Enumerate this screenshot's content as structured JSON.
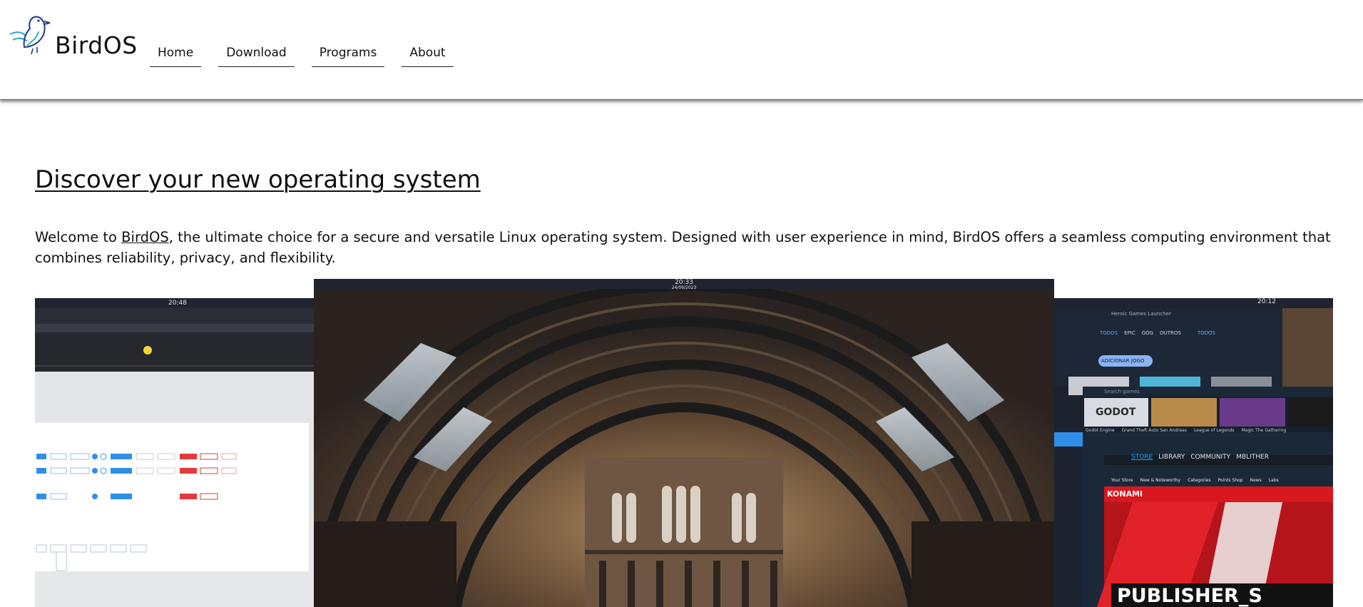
{
  "header": {
    "brand": "BirdOS",
    "nav": [
      {
        "label": "Home"
      },
      {
        "label": "Download"
      },
      {
        "label": "Programs"
      },
      {
        "label": "About"
      }
    ]
  },
  "main": {
    "title": "Discover your new operating system",
    "intro_prefix": "Welcome to ",
    "intro_link": "BirdOS",
    "intro_suffix": ", the ultimate choice for a secure and versatile Linux operating system. Designed with user experience in mind, BirdOS offers a seamless computing environment that combines reliability, privacy, and flexibility."
  },
  "gallery": {
    "left": {
      "clock": "20:48"
    },
    "center": {
      "clock": "20:33",
      "date": "24/09/2023"
    },
    "right": {
      "clock": "20:12",
      "launcher_title": "Heroic Games Launcher",
      "launcher_tabs": [
        "TODOS",
        "EPIC",
        "GOG",
        "OUTROS",
        "TODOS"
      ],
      "add_game": "ADICIONAR JOGO",
      "search_placeholder": "Search games",
      "games": [
        "GODOT",
        "Godot Engine",
        "Grand Theft Auto San Andreas",
        "League of Legends",
        "Magic The Gathering"
      ],
      "steam_nav": [
        "STORE",
        "LIBRARY",
        "COMMUNITY",
        "MBLITHER"
      ],
      "store_nav": [
        "Your Store",
        "New & Noteworthy",
        "Categories",
        "Points Shop",
        "News",
        "Labs"
      ],
      "banner_brand": "KONAMI",
      "banner_text": "PUBLISHER_S"
    }
  },
  "colors": {
    "accent_blue": "#2f8fe8",
    "steam_bg": "#1b2838",
    "konami_red": "#d8171e"
  }
}
